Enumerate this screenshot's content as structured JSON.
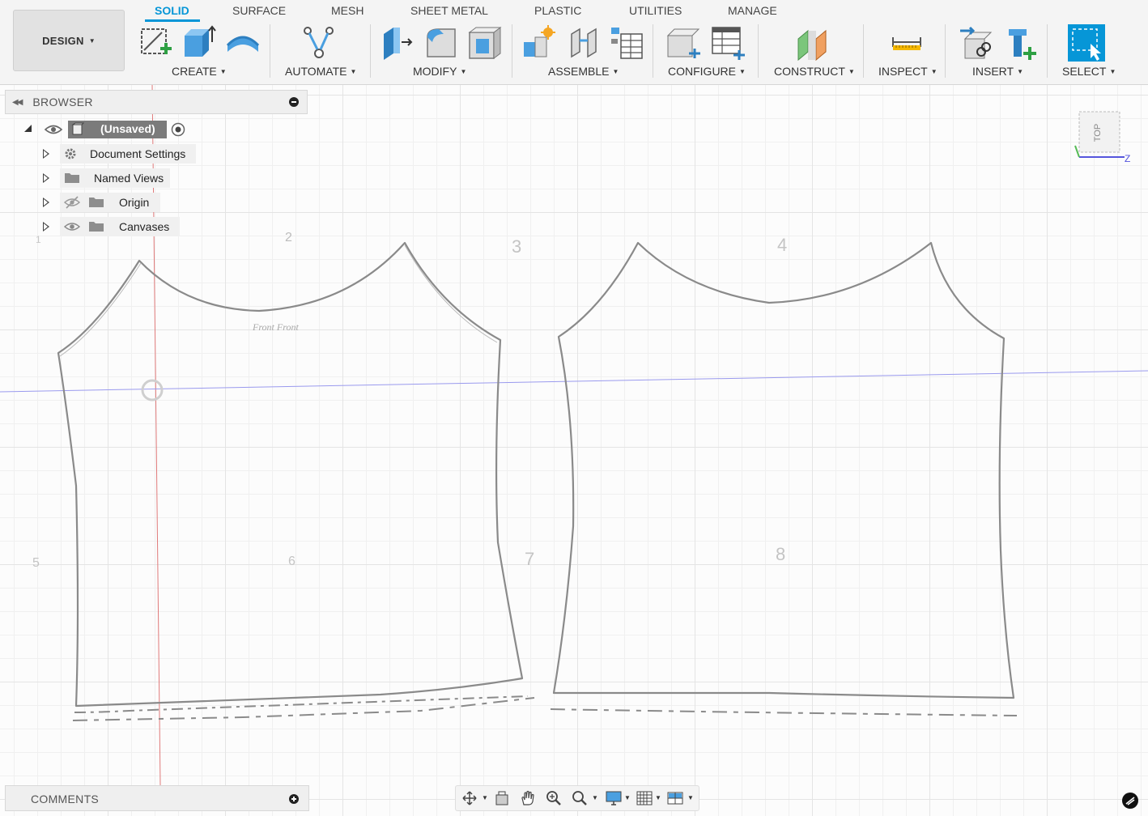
{
  "workspace": {
    "label": "DESIGN",
    "icon": "caret-down-icon"
  },
  "tabs": [
    {
      "label": "SOLID",
      "active": true
    },
    {
      "label": "SURFACE",
      "active": false
    },
    {
      "label": "MESH",
      "active": false
    },
    {
      "label": "SHEET METAL",
      "active": false
    },
    {
      "label": "PLASTIC",
      "active": false
    },
    {
      "label": "UTILITIES",
      "active": false
    },
    {
      "label": "MANAGE",
      "active": false
    }
  ],
  "toolbar": {
    "groups": [
      {
        "label": "CREATE",
        "tools": [
          "create-sketch-icon",
          "extrude-icon",
          "revolve-icon"
        ]
      },
      {
        "label": "AUTOMATE",
        "tools": [
          "automate-icon"
        ]
      },
      {
        "label": "MODIFY",
        "tools": [
          "press-pull-icon",
          "fillet-icon",
          "shell-icon"
        ]
      },
      {
        "label": "ASSEMBLE",
        "tools": [
          "new-component-icon",
          "joint-icon",
          "table-icon"
        ]
      },
      {
        "label": "CONFIGURE",
        "tools": [
          "configure-icon",
          "configuration-table-icon"
        ]
      },
      {
        "label": "CONSTRUCT",
        "tools": [
          "offset-plane-icon"
        ]
      },
      {
        "label": "INSPECT",
        "tools": [
          "measure-icon"
        ]
      },
      {
        "label": "INSERT",
        "tools": [
          "insert-derive-icon",
          "insert-mcmaster-icon"
        ]
      },
      {
        "label": "SELECT",
        "tools": [
          "select-icon"
        ]
      }
    ]
  },
  "browser": {
    "title": "BROWSER",
    "root": {
      "label": "(Unsaved)"
    },
    "items": [
      {
        "label": "Document Settings",
        "icon": "gear-icon"
      },
      {
        "label": "Named Views",
        "icon": "folder-icon"
      },
      {
        "label": "Origin",
        "icon": "folder-icon",
        "visibility": "hidden"
      },
      {
        "label": "Canvases",
        "icon": "folder-icon",
        "visibility": "visible"
      }
    ]
  },
  "comments": {
    "title": "COMMENTS"
  },
  "viewcube": {
    "face": "TOP",
    "axis_label": "Z"
  },
  "canvas": {
    "sketch_labels": [
      "2",
      "3",
      "4",
      "5",
      "6",
      "7",
      "8",
      "Front Front",
      "1"
    ],
    "colors": {
      "accent": "#0696d7",
      "x_axis": "#e06060",
      "z_axis": "#8a8ae6"
    }
  },
  "navbar": {
    "tools": [
      "orbit-icon",
      "look-at-icon",
      "pan-icon",
      "zoom-icon",
      "fit-icon",
      "display-settings-icon",
      "grid-icon",
      "viewports-icon"
    ]
  }
}
